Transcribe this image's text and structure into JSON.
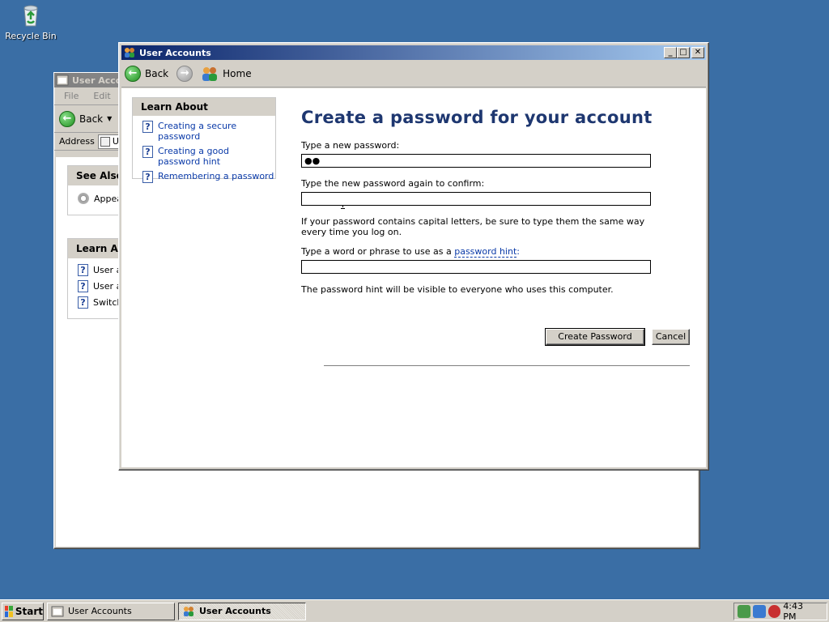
{
  "desktop": {
    "recycle_bin_label": "Recycle Bin"
  },
  "back_window": {
    "title": "User Accou",
    "menu": [
      "File",
      "Edit"
    ],
    "back_label": "Back",
    "address_label": "Address",
    "address_value": "U",
    "see_also": {
      "heading": "See Also",
      "items": [
        "Appea"
      ]
    },
    "learn_about": {
      "heading": "Learn Abo",
      "items": [
        "User a",
        "User a",
        "Switch"
      ]
    }
  },
  "front_window": {
    "title": "User Accounts",
    "nav": {
      "back_label": "Back",
      "home_label": "Home"
    },
    "learn_about": {
      "heading": "Learn About",
      "items": [
        "Creating a secure password",
        "Creating a good password hint",
        "Remembering a password"
      ]
    },
    "heading": "Create a password for your account",
    "new_password_label": "Type a new password:",
    "new_password_value": "●●",
    "confirm_label": "Type the new password again to confirm:",
    "confirm_value": "",
    "caps_note": "If your password contains capital letters, be sure to type them the same way every time you log on.",
    "hint_label_prefix": "Type a word or phrase to use as a ",
    "hint_label_link": "password hint",
    "hint_label_suffix": ":",
    "hint_value": "",
    "hint_note": "The password hint will be visible to everyone who uses this computer.",
    "create_button": "Create Password",
    "cancel_button": "Cancel"
  },
  "taskbar": {
    "start_label": "Start",
    "tasks": [
      {
        "label": "User Accounts",
        "active": false
      },
      {
        "label": "User Accounts",
        "active": true
      }
    ],
    "clock": "4:43 PM"
  },
  "colors": {
    "desktop": "#3a6ea5",
    "title_active": "#0a246a",
    "link": "#0a3aa8",
    "heading": "#1e3770"
  }
}
